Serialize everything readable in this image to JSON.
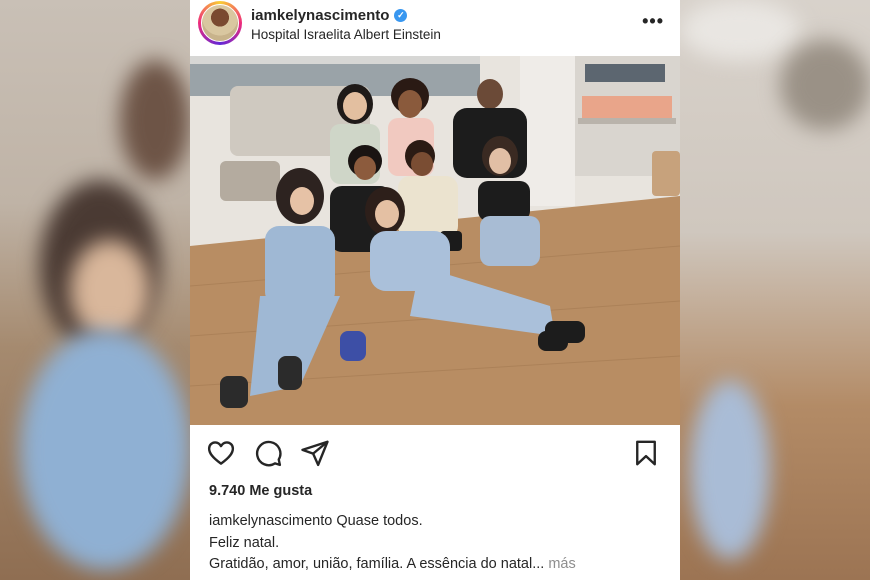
{
  "post": {
    "username": "iamkelynascimento",
    "location": "Hospital Israelita Albert Einstein",
    "likes": "9.740 Me gusta",
    "caption_text": "Quase todos.",
    "caption_line2": "Feliz natal.",
    "caption_line3": "Gratidão, amor, união, família. A essência do natal...",
    "more_label": "más"
  },
  "icons": {
    "verified": "verified-badge-icon",
    "more": "more-options-icon",
    "like": "heart-icon",
    "comment": "comment-icon",
    "share": "send-icon",
    "save": "bookmark-icon"
  },
  "colors": {
    "text": "#262626",
    "muted": "#8e8e8e",
    "verified": "#3897f0"
  }
}
